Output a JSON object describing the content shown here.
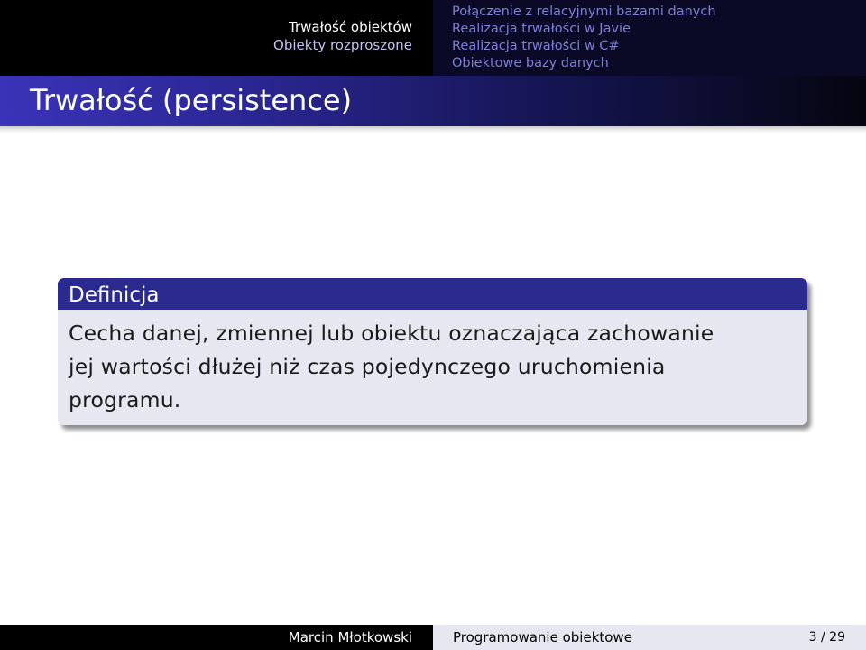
{
  "header": {
    "sections": [
      {
        "label": "Trwałość obiektów",
        "current": true
      },
      {
        "label": "Obiekty rozproszone",
        "current": false
      }
    ],
    "subsections": [
      "Połączenie z relacyjnymi bazami danych",
      "Realizacja trwałości w Javie",
      "Realizacja trwałości w C#",
      "Obiektowe bazy danych"
    ]
  },
  "frame": {
    "title": "Trwałość (persistence)"
  },
  "definition_block": {
    "title": "Definicja",
    "lines": [
      "Cecha danej, zmiennej lub obiektu oznaczająca zachowanie",
      "jej wartości dłużej niż czas pojedynczego uruchomienia",
      "programu."
    ]
  },
  "footer": {
    "author": "Marcin Młotkowski",
    "title": "Programowanie obiektowe",
    "page": "3 / 29"
  },
  "colors": {
    "header_left": "#000000",
    "header_right": "#0a0a26",
    "nav_active": "#ffffff",
    "nav_inactive": "#7f7fd6",
    "block_title_bg": "#2b2a8f",
    "block_body_bg": "#e7e7f1",
    "title_gradient_start": "#3a33b8"
  }
}
